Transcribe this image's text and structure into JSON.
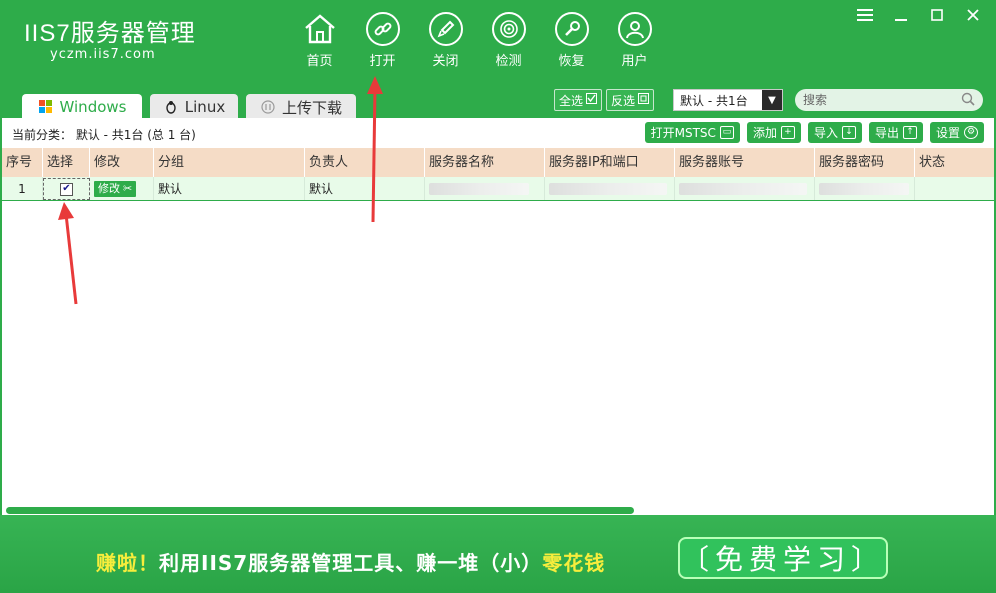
{
  "app": {
    "logo_text": "IIS7服务器管理",
    "logo_url": "yczm.iis7.com"
  },
  "nav": [
    {
      "label": "首页",
      "icon": "home-icon"
    },
    {
      "label": "打开",
      "icon": "link-icon"
    },
    {
      "label": "关闭",
      "icon": "rocket-icon"
    },
    {
      "label": "检测",
      "icon": "radar-icon"
    },
    {
      "label": "恢复",
      "icon": "wrench-icon"
    },
    {
      "label": "用户",
      "icon": "user-icon"
    }
  ],
  "tabs": [
    {
      "label": "Windows",
      "icon": "windows-icon"
    },
    {
      "label": "Linux",
      "icon": "linux-icon"
    },
    {
      "label": "上传下载",
      "icon": "transfer-icon"
    }
  ],
  "toolbar": {
    "select_all": "全选",
    "invert": "反选",
    "category": "默认 - 共1台",
    "search_placeholder": "搜索"
  },
  "info": "当前分类： 默认 - 共1台 (总 1 台)",
  "actions": [
    {
      "label": "打开MSTSC",
      "icon": "monitor-icon"
    },
    {
      "label": "添加",
      "icon": "add-icon"
    },
    {
      "label": "导入",
      "icon": "import-icon"
    },
    {
      "label": "导出",
      "icon": "export-icon"
    },
    {
      "label": "设置",
      "icon": "gear-icon"
    }
  ],
  "table": {
    "headers": [
      "序号",
      "选择",
      "修改",
      "分组",
      "负责人",
      "服务器名称",
      "服务器IP和端口",
      "服务器账号",
      "服务器密码",
      "状态"
    ],
    "rows": [
      {
        "index": "1",
        "checked": true,
        "edit": "修改",
        "group": "默认",
        "owner": "默认"
      }
    ]
  },
  "banner": {
    "prefix": "赚啦！",
    "middle": "利用IIS7服务器管理工具、赚一堆（小）",
    "suffix": "零花钱",
    "button": "〔免费学习〕"
  },
  "colors": {
    "brand_green": "#2eac4a",
    "header_row": "#f5dcc6",
    "highlight_yellow": "#f7ed3c",
    "arrow_red": "#e83a3a"
  }
}
